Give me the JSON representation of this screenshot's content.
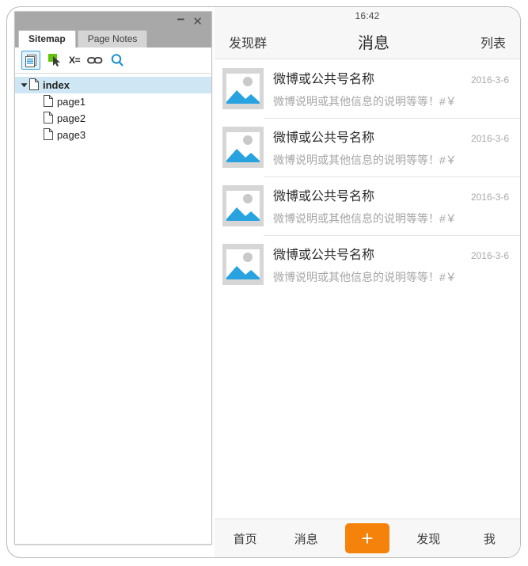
{
  "sitemap_panel": {
    "titlebar": {
      "minimize": "−",
      "close": "✕"
    },
    "tabs": [
      {
        "label": "Sitemap",
        "active": true
      },
      {
        "label": "Page Notes",
        "active": false
      }
    ],
    "toolbar": [
      {
        "name": "page-icon",
        "label": "",
        "selected": true
      },
      {
        "name": "cursor-icon",
        "label": "",
        "selected": false
      },
      {
        "name": "variable-icon",
        "label": "X=",
        "selected": false
      },
      {
        "name": "link-icon",
        "label": "",
        "selected": false
      },
      {
        "name": "search-icon",
        "label": "",
        "selected": false
      }
    ],
    "tree": [
      {
        "label": "index",
        "level": 0,
        "selected": true,
        "expanded": true
      },
      {
        "label": "page1",
        "level": 1,
        "selected": false
      },
      {
        "label": "page2",
        "level": 1,
        "selected": false
      },
      {
        "label": "page3",
        "level": 1,
        "selected": false
      }
    ]
  },
  "device": {
    "status_bar": {
      "time": "16:42"
    },
    "nav_bar": {
      "left": "发现群",
      "title": "消息",
      "right": "列表"
    },
    "messages": [
      {
        "title": "微博或公共号名称",
        "date": "2016-3-6",
        "subtitle": "微博说明或其他信息的说明等等！#￥"
      },
      {
        "title": "微博或公共号名称",
        "date": "2016-3-6",
        "subtitle": "微博说明或其他信息的说明等等！#￥"
      },
      {
        "title": "微博或公共号名称",
        "date": "2016-3-6",
        "subtitle": "微博说明或其他信息的说明等等！#￥"
      },
      {
        "title": "微博或公共号名称",
        "date": "2016-3-6",
        "subtitle": "微博说明或其他信息的说明等等！#￥"
      }
    ],
    "tab_bar": {
      "items": [
        {
          "label": "首页",
          "type": "text"
        },
        {
          "label": "消息",
          "type": "text"
        },
        {
          "label": "+",
          "type": "plus"
        },
        {
          "label": "发现",
          "type": "text"
        },
        {
          "label": "我",
          "type": "text"
        }
      ]
    }
  },
  "colors": {
    "accent_orange": "#f5820b",
    "accent_blue": "#29a3e0",
    "tree_selection": "#cfe7f5",
    "titlebar_gray": "#a8a8a8",
    "thumb_gray": "#d6d6d6"
  }
}
